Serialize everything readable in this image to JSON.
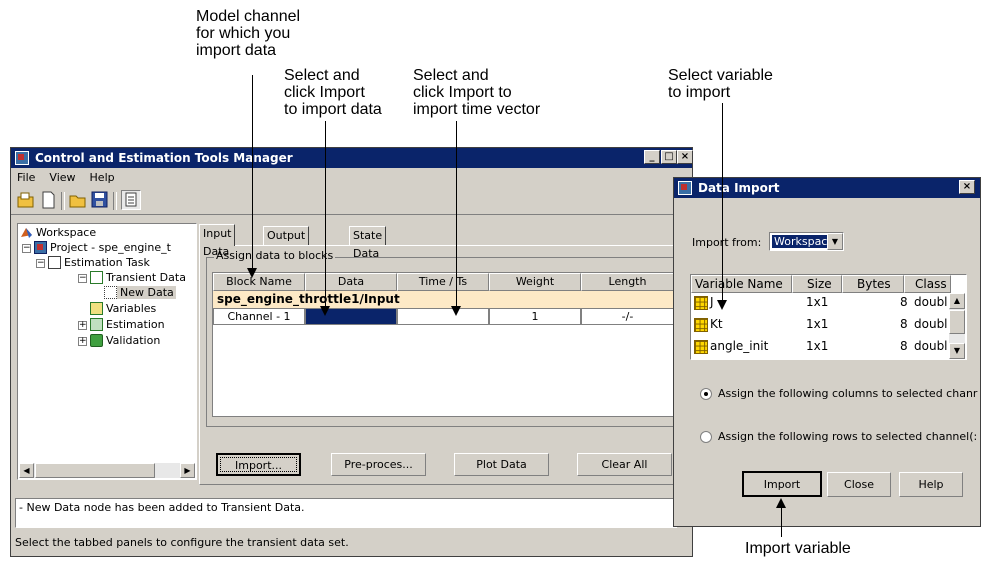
{
  "annotations": {
    "model_channel": "Model channel\nfor which you\nimport data",
    "select_import_data": "Select and\nclick Import\nto import data",
    "select_import_time": "Select and\nclick Import to\nimport time vector",
    "select_variable": "Select variable\n to import",
    "import_variable": "Import variable"
  },
  "main_window": {
    "title": "Control and Estimation Tools Manager",
    "menu": [
      "File",
      "View",
      "Help"
    ],
    "tree": {
      "workspace": "Workspace",
      "project": "Project - spe_engine_t",
      "estimation_task": "Estimation Task",
      "transient_data": "Transient Data",
      "new_data": "New Data",
      "variables": "Variables",
      "estimation": "Estimation",
      "validation": "Validation"
    },
    "tabs": [
      "Input Data",
      "Output Data",
      "State Data"
    ],
    "group_label": "Assign data to blocks",
    "columns": [
      "Block Name",
      "Data",
      "Time / Ts",
      "Weight",
      "Length"
    ],
    "block_header": "spe_engine_throttle1/Input",
    "row": {
      "block_name": "Channel - 1",
      "data": "",
      "time": "",
      "weight": "1",
      "length": "-/-"
    },
    "buttons": [
      "Import...",
      "Pre-proces...",
      "Plot Data",
      "Clear All"
    ],
    "message": "- New Data node has been added to Transient Data.",
    "status": "Select the tabbed panels to configure the transient data set."
  },
  "dialog": {
    "title": "Data Import",
    "import_from_label": "Import from:",
    "import_from_value": "Workspace",
    "columns": [
      "Variable Name",
      "Size",
      "Bytes",
      "Class"
    ],
    "rows": [
      {
        "name": "J",
        "size": "1x1",
        "bytes": "8",
        "class": "doubl"
      },
      {
        "name": "Kt",
        "size": "1x1",
        "bytes": "8",
        "class": "doubl"
      },
      {
        "name": "angle_init",
        "size": "1x1",
        "bytes": "8",
        "class": "doubl"
      }
    ],
    "radio_columns": "Assign the following columns to selected chanr",
    "radio_rows": "Assign the following rows to selected channel(:",
    "buttons": [
      "Import",
      "Close",
      "Help"
    ]
  },
  "colors": {
    "titlebar": "#0a246a",
    "selected_cell": "#0a246a",
    "block_header_bg": "#fde9c6"
  }
}
